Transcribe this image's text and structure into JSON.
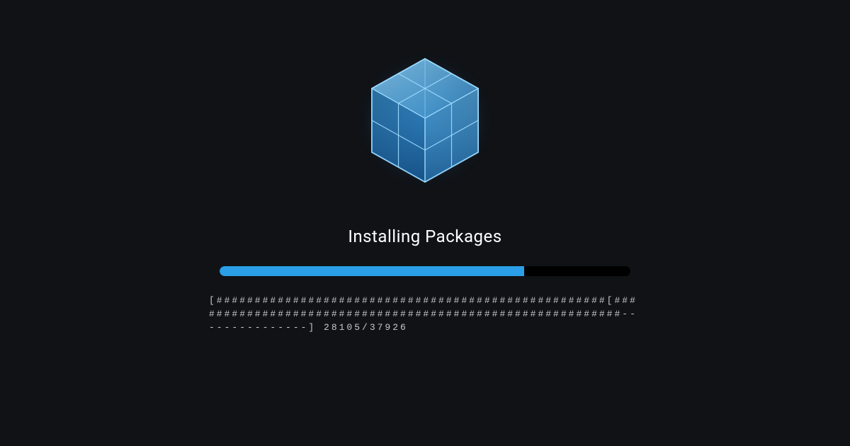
{
  "status_text": "Installing Packages",
  "progress": {
    "current": 28105,
    "total": 37926,
    "percent": 74.1,
    "counter_label": "28105/37926"
  },
  "ascii_bar": "[###################################################[#########################################################---------------] 28105/37926",
  "colors": {
    "background": "#101216",
    "accent": "#2a9fe8",
    "cube_light": "#6fc8ff",
    "cube_mid": "#3aa0e8",
    "cube_dark": "#1a6db8"
  },
  "icon": "cube-isometric"
}
